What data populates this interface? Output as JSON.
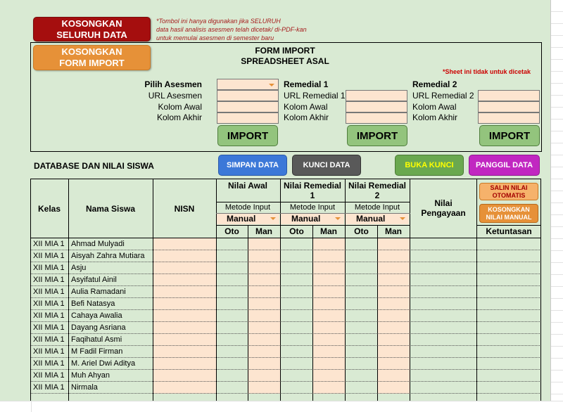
{
  "buttons": {
    "clear_all": "KOSONGKAN SELURUH DATA",
    "clear_import": "KOSONGKAN FORM IMPORT",
    "save": "SIMPAN DATA",
    "lock": "KUNCI DATA",
    "unlock": "BUKA KUNCI",
    "call": "PANGGIL DATA",
    "copy_auto": "SALIN NILAI OTOMATIS",
    "clear_manual": "KOSONGKAN NILAI MANUAL",
    "import": "IMPORT"
  },
  "note_lines": [
    "*Tombol ini hanya digunakan jika SELURUH",
    "data hasil analisis asesmen telah dicetak/ di-PDF-kan",
    "untuk memulai asesmen di semester baru"
  ],
  "form": {
    "title_line1": "FORM IMPORT",
    "title_line2": "SPREADSHEET ASAL",
    "sheet_note": "*Sheet ini tidak untuk dicetak",
    "col1": {
      "head": "Pilih Asesmen",
      "url": "URL Asesmen",
      "start": "Kolom Awal",
      "end": "Kolom Akhir"
    },
    "col2": {
      "head": "Remedial 1",
      "url": "URL Remedial 1",
      "start": "Kolom Awal",
      "end": "Kolom Akhir"
    },
    "col3": {
      "head": "Remedial 2",
      "url": "URL Remedial 2",
      "start": "Kolom Awal",
      "end": "Kolom Akhir"
    }
  },
  "section_title": "DATABASE DAN NILAI SISWA",
  "table": {
    "h_kelas": "Kelas",
    "h_nama": "Nama Siswa",
    "h_nisn": "NISN",
    "h_awal": "Nilai Awal",
    "h_rem1": "Nilai Remedial 1",
    "h_rem2": "Nilai Remedial 2",
    "h_pengayaan": "Nilai Pengayaan",
    "h_ketuntasan": "Ketuntasan",
    "metode": "Metode Input",
    "manual": "Manual",
    "oto": "Oto",
    "man": "Man",
    "rows": [
      {
        "kelas": "XII MIA 1",
        "nama": "Ahmad Mulyadi"
      },
      {
        "kelas": "XII MIA 1",
        "nama": "Aisyah Zahra Mutiara"
      },
      {
        "kelas": "XII MIA 1",
        "nama": "Asju"
      },
      {
        "kelas": "XII MIA 1",
        "nama": "Asyifatul Ainil"
      },
      {
        "kelas": "XII MIA 1",
        "nama": "Aulia Ramadani"
      },
      {
        "kelas": "XII MIA 1",
        "nama": "Befi Natasya"
      },
      {
        "kelas": "XII MIA 1",
        "nama": "Cahaya Awalia"
      },
      {
        "kelas": "XII MIA 1",
        "nama": "Dayang Asriana"
      },
      {
        "kelas": "XII MIA 1",
        "nama": "Faqihatul Asmi"
      },
      {
        "kelas": "XII MIA 1",
        "nama": "M Fadil Firman"
      },
      {
        "kelas": "XII MIA 1",
        "nama": "M. Ariel Dwi Aditya"
      },
      {
        "kelas": "XII MIA 1",
        "nama": "Muh Ahyan"
      },
      {
        "kelas": "XII MIA 1",
        "nama": "Nirmala"
      }
    ]
  }
}
